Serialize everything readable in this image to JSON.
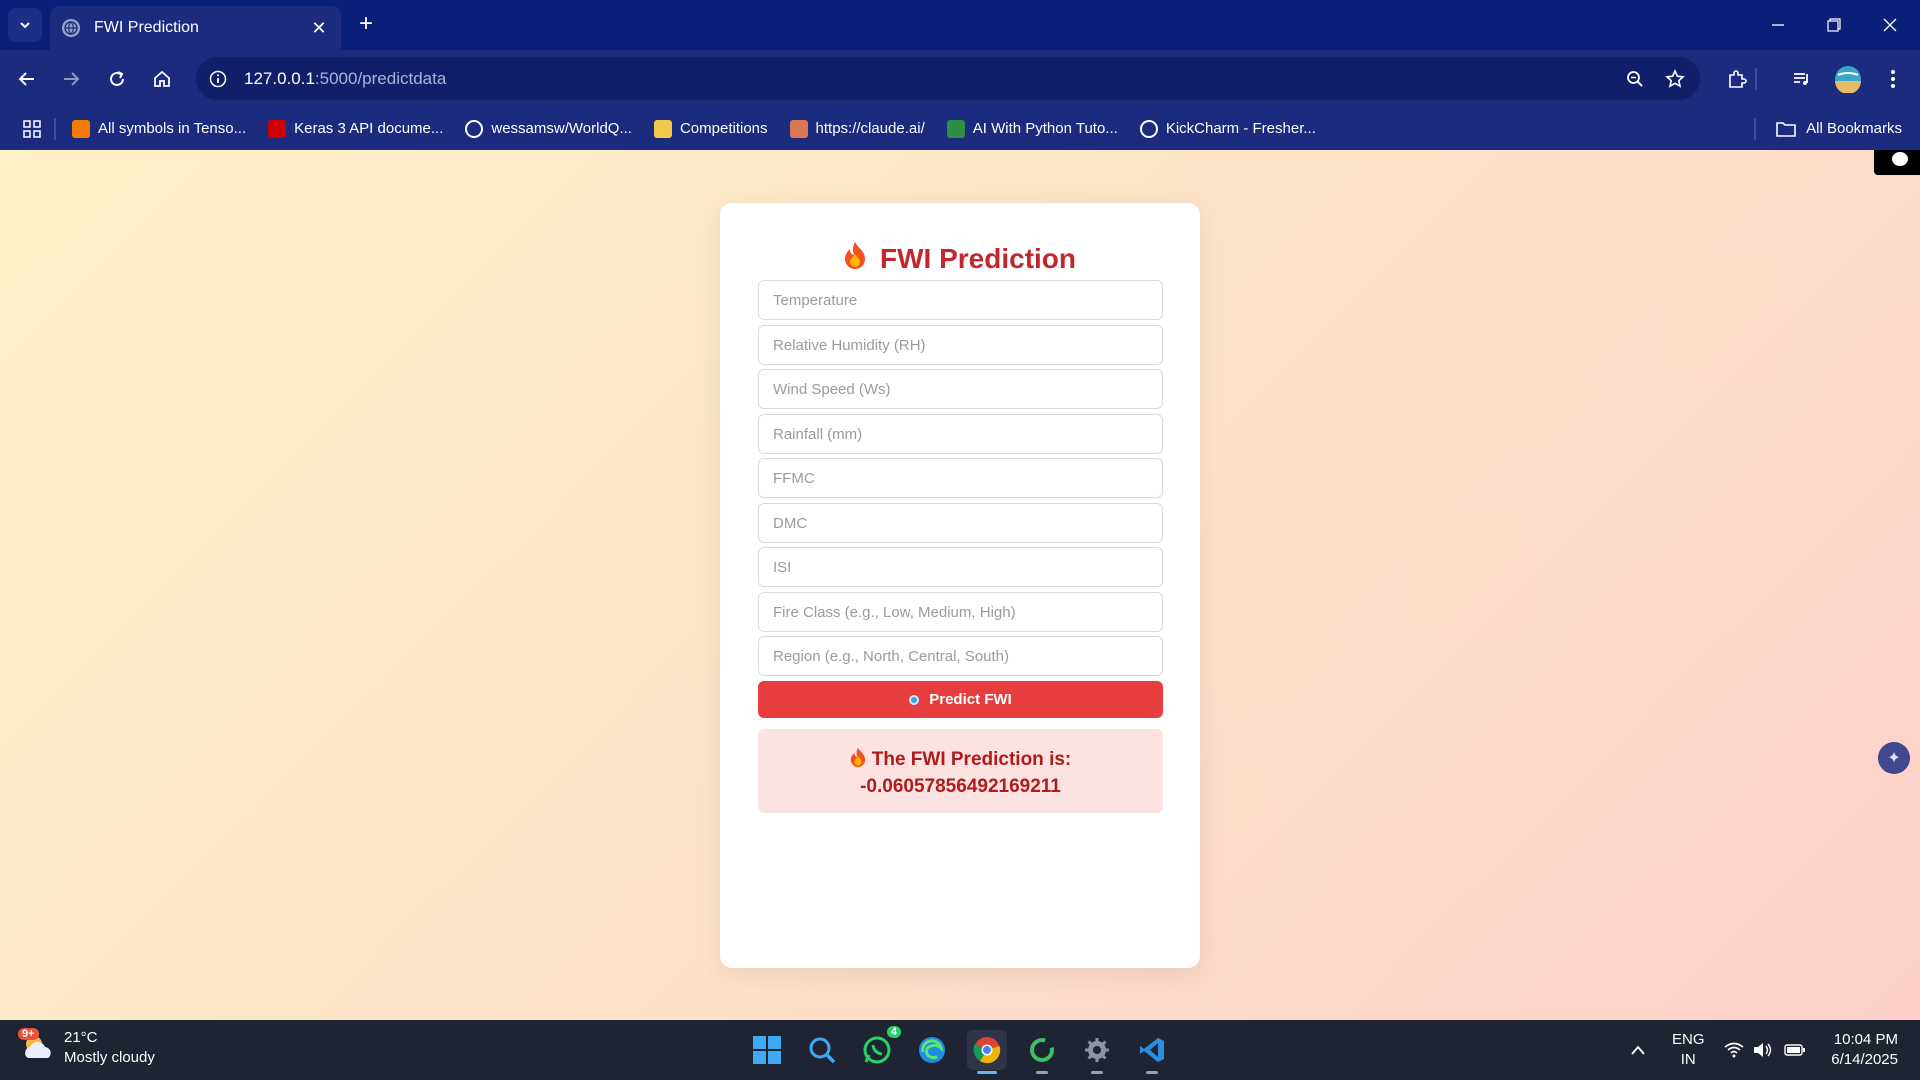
{
  "browser": {
    "tab_title": "FWI Prediction",
    "url_host": "127.0.0.1",
    "url_path": ":5000/predictdata",
    "bookmarks": [
      {
        "label": "All symbols in Tenso...",
        "icon": "tensorflow-icon",
        "color": "#f57c00"
      },
      {
        "label": "Keras 3 API docume...",
        "icon": "keras-icon",
        "color": "#d00000"
      },
      {
        "label": "wessamsw/WorldQ...",
        "icon": "github-icon",
        "color": "#ffffff"
      },
      {
        "label": "Competitions",
        "icon": "competitions-icon",
        "color": "#f2c94c"
      },
      {
        "label": "https://claude.ai/",
        "icon": "claude-icon",
        "color": "#d97757"
      },
      {
        "label": "AI With Python Tuto...",
        "icon": "geeksforgeeks-icon",
        "color": "#2f8d46"
      },
      {
        "label": "KickCharm - Fresher...",
        "icon": "kickcharm-icon",
        "color": "#ffffff"
      }
    ],
    "all_bookmarks": "All Bookmarks"
  },
  "page": {
    "title": "FWI Prediction",
    "inputs": [
      {
        "name": "temperature-input",
        "placeholder": "Temperature"
      },
      {
        "name": "humidity-input",
        "placeholder": "Relative Humidity (RH)"
      },
      {
        "name": "wind-speed-input",
        "placeholder": "Wind Speed (Ws)"
      },
      {
        "name": "rainfall-input",
        "placeholder": "Rainfall (mm)"
      },
      {
        "name": "ffmc-input",
        "placeholder": "FFMC"
      },
      {
        "name": "dmc-input",
        "placeholder": "DMC"
      },
      {
        "name": "isi-input",
        "placeholder": "ISI"
      },
      {
        "name": "fire-class-input",
        "placeholder": "Fire Class (e.g., Low, Medium, High)"
      },
      {
        "name": "region-input",
        "placeholder": "Region (e.g., North, Central, South)"
      }
    ],
    "button_label": "Predict FWI",
    "result_label": "The FWI Prediction is:",
    "result_value": "-0.06057856492169211",
    "accent_color": "#e63e3e",
    "title_color": "#c1272d"
  },
  "taskbar": {
    "weather_temp": "21°C",
    "weather_desc": "Mostly cloudy",
    "weather_badge": "9+",
    "whatsapp_badge": "4",
    "lang_line1": "ENG",
    "lang_line2": "IN",
    "time": "10:04 PM",
    "date": "6/14/2025"
  }
}
